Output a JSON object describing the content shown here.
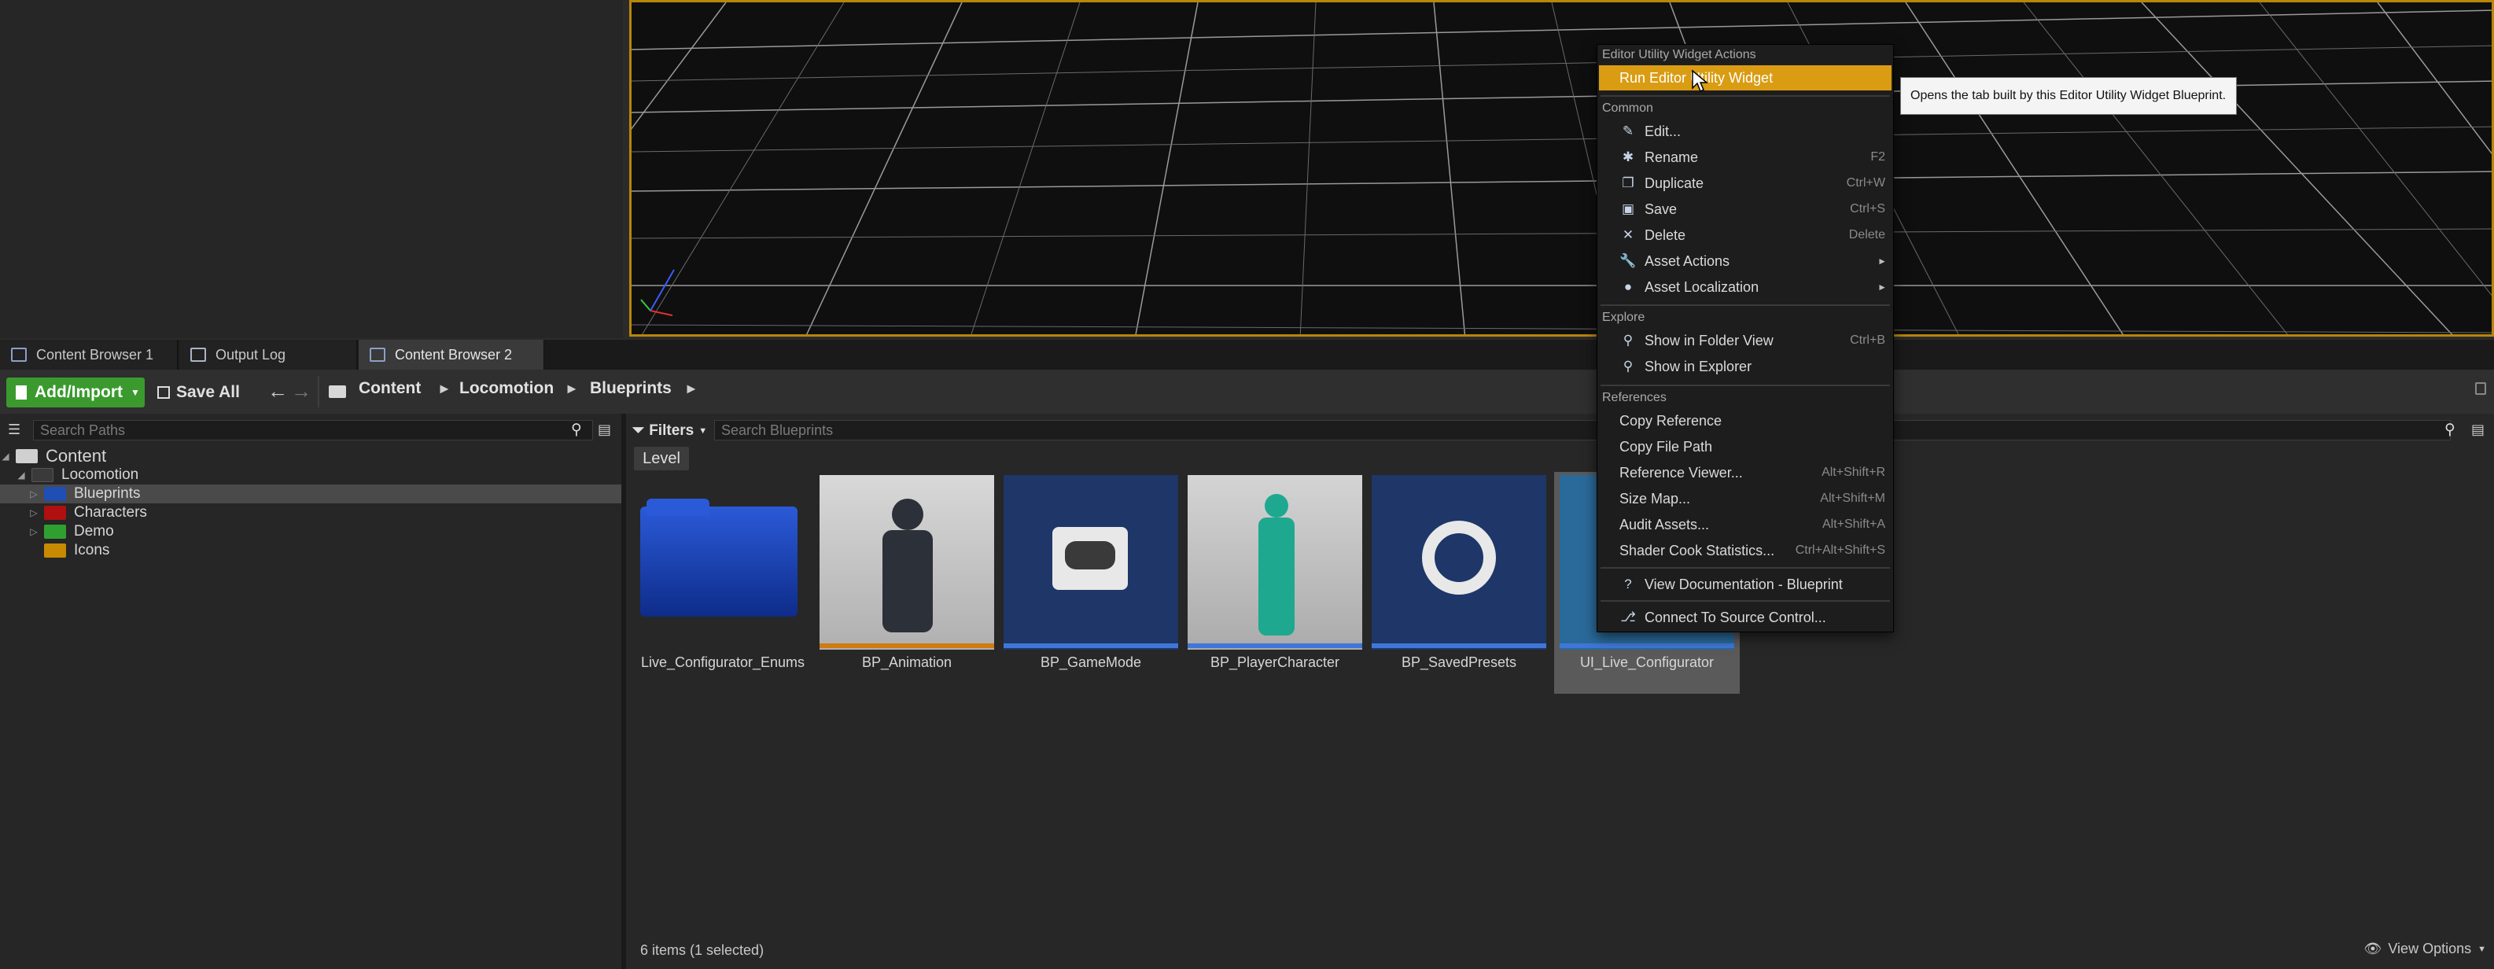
{
  "tabs": [
    {
      "label": "Content Browser 1"
    },
    {
      "label": "Output Log"
    },
    {
      "label": "Content Browser 2"
    }
  ],
  "toolbar": {
    "add_import": "Add/Import",
    "save_all": "Save All",
    "breadcrumb": [
      "Content",
      "Locomotion",
      "Blueprints"
    ]
  },
  "paths": {
    "search_placeholder": "Search Paths",
    "tree": [
      {
        "label": "Content"
      },
      {
        "label": "Locomotion"
      },
      {
        "label": "Blueprints"
      },
      {
        "label": "Characters"
      },
      {
        "label": "Demo"
      },
      {
        "label": "Icons"
      }
    ]
  },
  "browser": {
    "filters_label": "Filters",
    "search_placeholder": "Search Blueprints",
    "level_chip": "Level",
    "assets": [
      {
        "name": "Live_Configurator_Enums"
      },
      {
        "name": "BP_Animation"
      },
      {
        "name": "BP_GameMode"
      },
      {
        "name": "BP_PlayerCharacter"
      },
      {
        "name": "BP_SavedPresets"
      },
      {
        "name": "UI_Live_Configurator"
      }
    ],
    "status": "6 items (1 selected)",
    "view_options": "View Options"
  },
  "context_menu": {
    "section_utility": "Editor Utility Widget Actions",
    "run_widget": "Run Editor Utility Widget",
    "section_common": "Common",
    "common": [
      {
        "label": "Edit...",
        "shortcut": "",
        "icon": "pencil-icon"
      },
      {
        "label": "Rename",
        "shortcut": "F2",
        "icon": "rename-icon"
      },
      {
        "label": "Duplicate",
        "shortcut": "Ctrl+W",
        "icon": "duplicate-icon"
      },
      {
        "label": "Save",
        "shortcut": "Ctrl+S",
        "icon": "save-icon"
      },
      {
        "label": "Delete",
        "shortcut": "Delete",
        "icon": "delete-icon"
      },
      {
        "label": "Asset Actions",
        "shortcut": "",
        "icon": "wrench-icon"
      },
      {
        "label": "Asset Localization",
        "shortcut": "",
        "icon": "globe-icon"
      }
    ],
    "section_explore": "Explore",
    "explore": [
      {
        "label": "Show in Folder View",
        "shortcut": "Ctrl+B"
      },
      {
        "label": "Show in Explorer",
        "shortcut": ""
      }
    ],
    "section_references": "References",
    "references": [
      {
        "label": "Copy Reference",
        "shortcut": ""
      },
      {
        "label": "Copy File Path",
        "shortcut": ""
      },
      {
        "label": "Reference Viewer...",
        "shortcut": "Alt+Shift+R"
      },
      {
        "label": "Size Map...",
        "shortcut": "Alt+Shift+M"
      },
      {
        "label": "Audit Assets...",
        "shortcut": "Alt+Shift+A"
      },
      {
        "label": "Shader Cook Statistics...",
        "shortcut": "Ctrl+Alt+Shift+S"
      }
    ],
    "view_docs": "View Documentation - Blueprint",
    "source_control": "Connect To Source Control..."
  },
  "tooltip": "Opens the tab built by this Editor Utility Widget Blueprint.",
  "colors": {
    "accent_orange": "#d99c12",
    "add_green": "#3a9a2e",
    "folder_blue": "#1f4fb5",
    "folder_red": "#b01010",
    "folder_green": "#2fa02f",
    "folder_yellow": "#c88a00"
  }
}
